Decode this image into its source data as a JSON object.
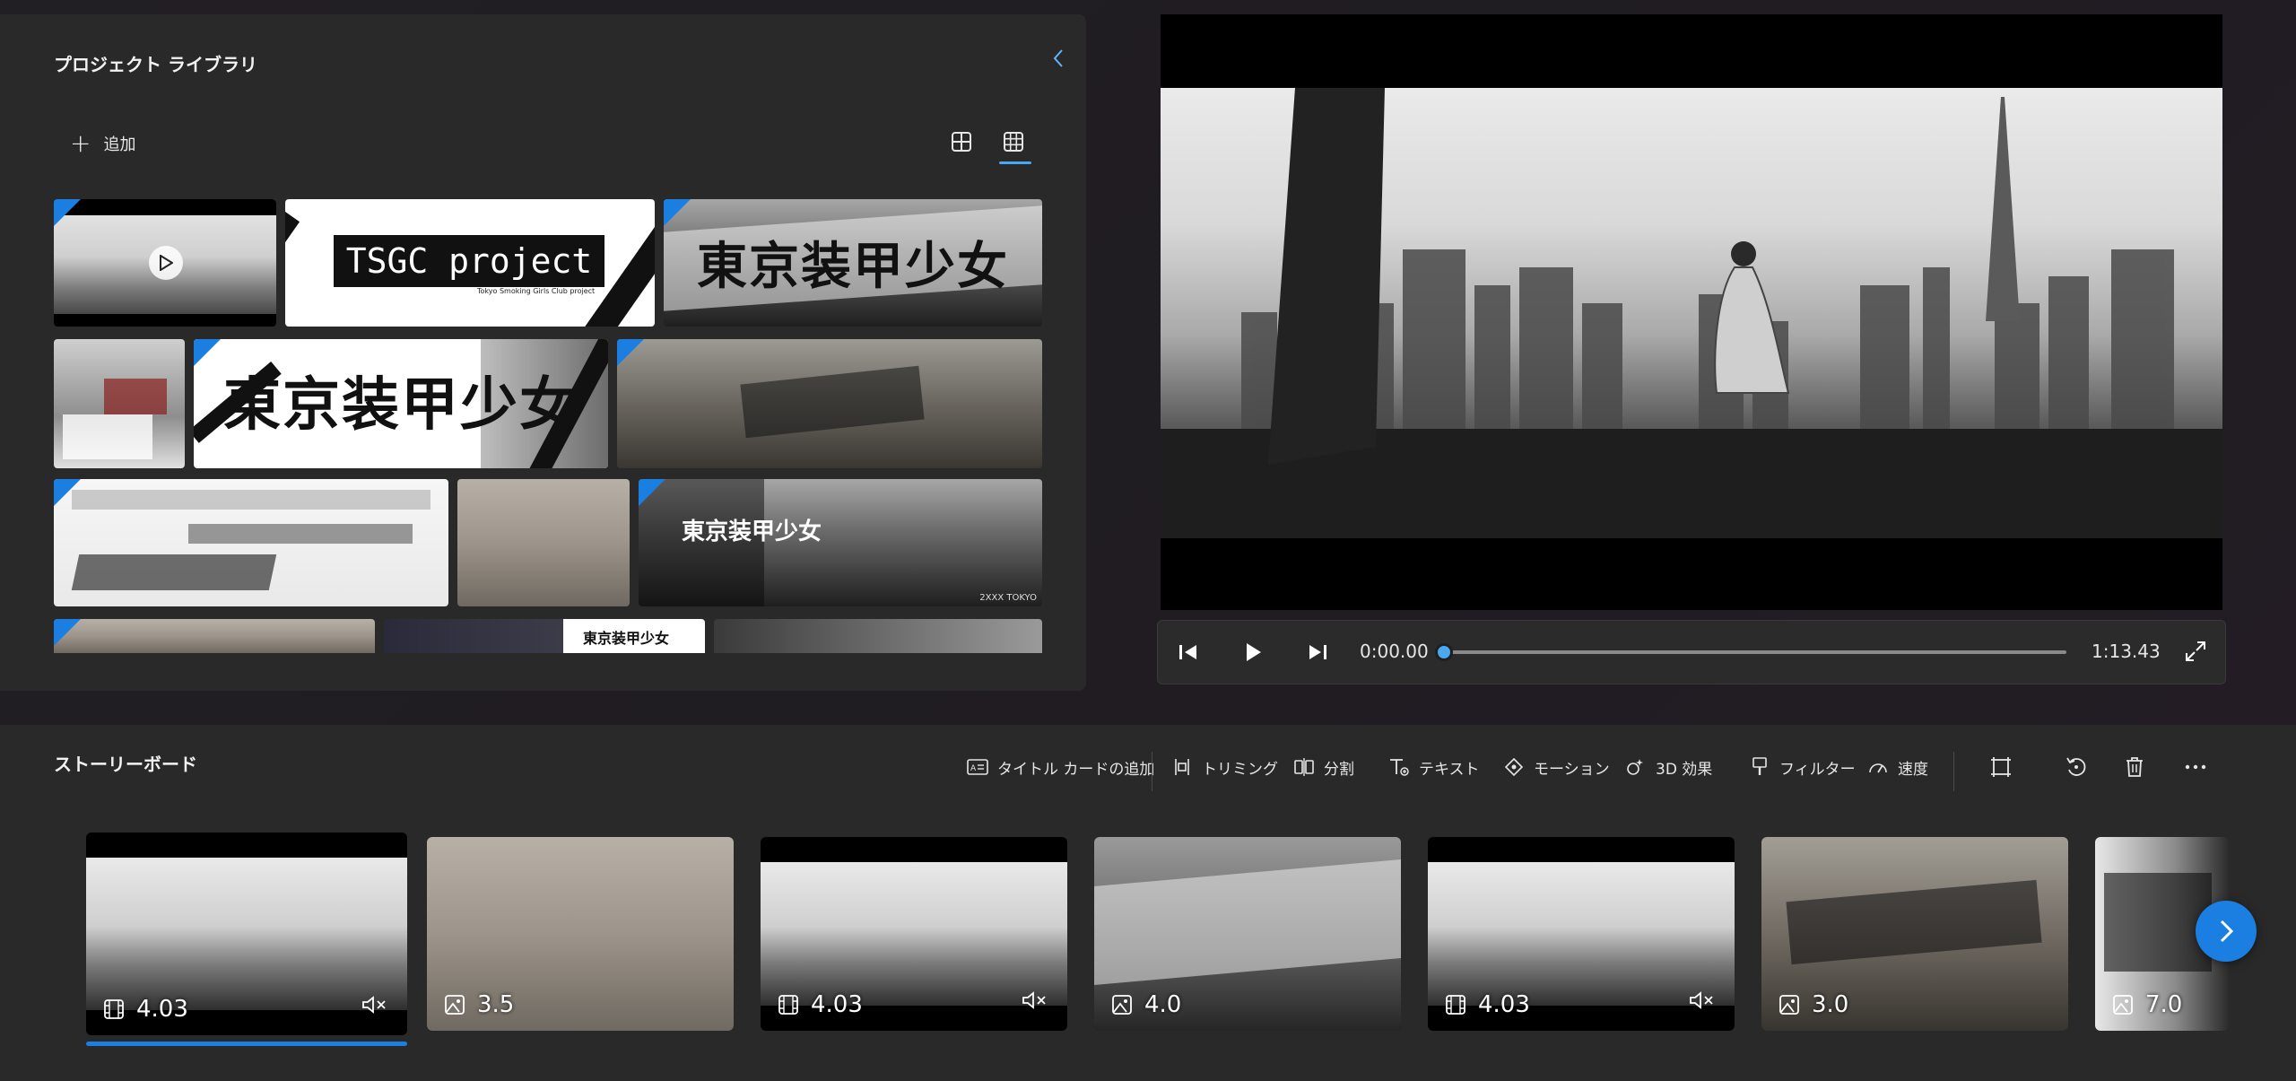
{
  "library": {
    "title": "プロジェクト ライブラリ",
    "add_label": "追加",
    "tiles": {
      "t2_title": "TSGC project",
      "t2_sub": "Tokyo Smoking Girls Club project",
      "t3_title": "東京装甲少女",
      "t5_title": "東京装甲少女",
      "t9_title": "東京装甲少女",
      "t9_caption": "2XXX TOKYO",
      "t12_label": "東京装甲少女"
    }
  },
  "player": {
    "current_time": "0:00.00",
    "total_time": "1:13.43",
    "progress": 0
  },
  "storyboard": {
    "title": "ストーリーボード",
    "toolbar": {
      "title_card": "タイトル カードの追加",
      "trim": "トリミング",
      "split": "分割",
      "text": "テキスト",
      "motion": "モーション",
      "effects3d": "3D 効果",
      "filter": "フィルター",
      "speed": "速度"
    },
    "clips": [
      {
        "kind": "video",
        "duration": "4.03",
        "muted": true
      },
      {
        "kind": "image",
        "duration": "3.5"
      },
      {
        "kind": "video",
        "duration": "4.03",
        "muted": true
      },
      {
        "kind": "image",
        "duration": "4.0"
      },
      {
        "kind": "video",
        "duration": "4.03",
        "muted": true
      },
      {
        "kind": "image",
        "duration": "3.0"
      },
      {
        "kind": "image",
        "duration": "7.0"
      }
    ]
  },
  "colors": {
    "accent": "#1a7fe0",
    "panel": "#292929",
    "background": "#221f24"
  }
}
